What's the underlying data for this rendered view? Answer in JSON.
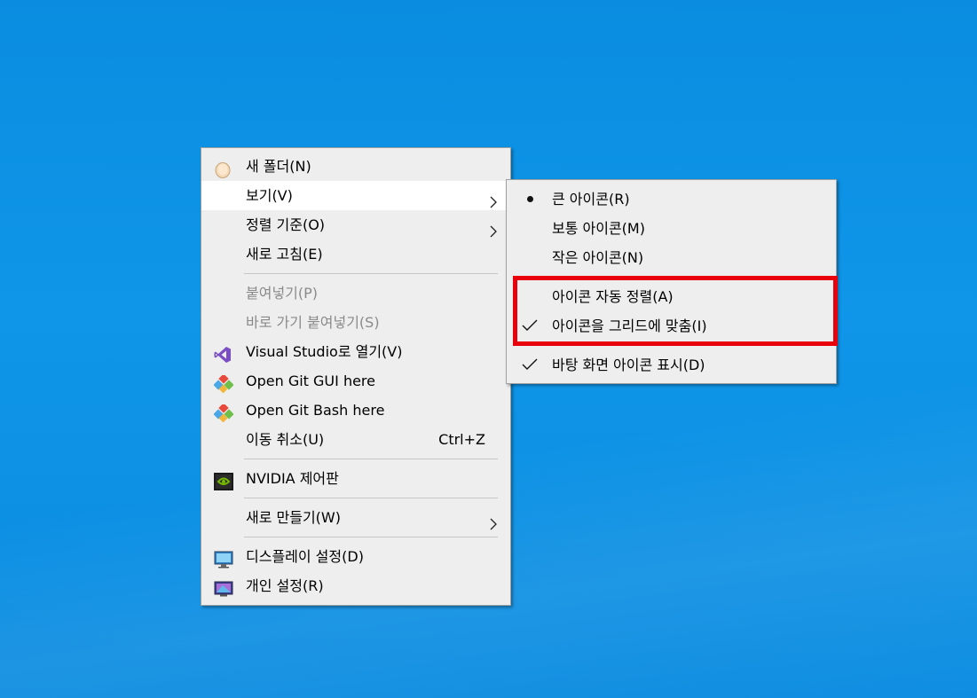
{
  "main_menu": {
    "items": [
      {
        "label": "새 폴더(N)",
        "icon": "new-folder-icon"
      },
      {
        "label": "보기(V)",
        "submenu": true,
        "hover": true
      },
      {
        "label": "정렬 기준(O)",
        "submenu": true
      },
      {
        "label": "새로 고침(E)"
      },
      {
        "label": "붙여넣기(P)",
        "disabled": true
      },
      {
        "label": "바로 가기 붙여넣기(S)",
        "disabled": true
      },
      {
        "label": "Visual Studio로 열기(V)",
        "icon": "visual-studio-icon"
      },
      {
        "label": "Open Git GUI here",
        "icon": "git-gui-icon"
      },
      {
        "label": "Open Git Bash here",
        "icon": "git-bash-icon"
      },
      {
        "label": "이동 취소(U)",
        "shortcut": "Ctrl+Z"
      },
      {
        "label": "NVIDIA 제어판",
        "icon": "nvidia-icon"
      },
      {
        "label": "새로 만들기(W)",
        "submenu": true
      },
      {
        "label": "디스플레이 설정(D)",
        "icon": "display-icon"
      },
      {
        "label": "개인 설정(R)",
        "icon": "personalize-icon"
      }
    ]
  },
  "view_submenu": {
    "items": [
      {
        "label": "큰 아이콘(R)",
        "mark": "bullet"
      },
      {
        "label": "보통 아이콘(M)"
      },
      {
        "label": "작은 아이콘(N)"
      },
      {
        "label": "아이콘 자동 정렬(A)"
      },
      {
        "label": "아이콘을 그리드에 맞춤(I)",
        "mark": "check"
      },
      {
        "label": "바탕 화면 아이콘 표시(D)",
        "mark": "check"
      }
    ]
  },
  "colors": {
    "desktop_background": "#0a8de0",
    "menu_background": "#eeeeee",
    "highlight_border": "#e8000c"
  }
}
